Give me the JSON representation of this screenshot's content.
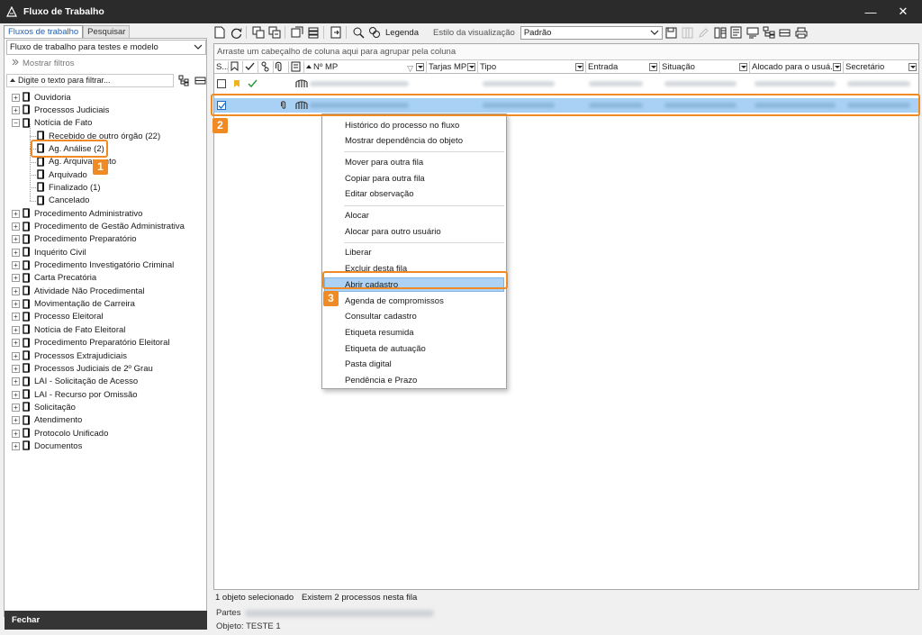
{
  "window": {
    "title": "Fluxo de Trabalho",
    "minimize_glyph": "—",
    "close_glyph": "✕",
    "icon": "app-logo-icon"
  },
  "left_panel": {
    "tabs": [
      {
        "label": "Fluxos de trabalho",
        "active": true
      },
      {
        "label": "Pesquisar",
        "active": false
      }
    ],
    "workflow_select": "Fluxo de trabalho para testes e modelo",
    "show_filters": "Mostrar filtros",
    "filter_placeholder": "Digite o texto para filtrar...",
    "tree": [
      {
        "label": "Ouvidoria",
        "expander": "+"
      },
      {
        "label": "Processos Judiciais",
        "expander": "+"
      },
      {
        "label": "Notícia de Fato",
        "expander": "−"
      },
      {
        "label": "Recebido de outro órgão (22)",
        "child": true
      },
      {
        "label": "Ag. Análise (2)",
        "child": true
      },
      {
        "label": "Ag. Arquivamento",
        "child": true
      },
      {
        "label": "Arquivado",
        "child": true
      },
      {
        "label": "Finalizado (1)",
        "child": true
      },
      {
        "label": "Cancelado",
        "child": true
      },
      {
        "label": "Procedimento Administrativo",
        "expander": "+"
      },
      {
        "label": "Procedimento de Gestão Administrativa",
        "expander": "+"
      },
      {
        "label": "Procedimento Preparatório",
        "expander": "+"
      },
      {
        "label": "Inquérito Civil",
        "expander": "+"
      },
      {
        "label": "Procedimento Investigatório Criminal",
        "expander": "+"
      },
      {
        "label": "Carta Precatória",
        "expander": "+"
      },
      {
        "label": "Atividade Não Procedimental",
        "expander": "+"
      },
      {
        "label": "Movimentação de Carreira",
        "expander": "+"
      },
      {
        "label": "Processo Eleitoral",
        "expander": "+"
      },
      {
        "label": "Notícia de Fato Eleitoral",
        "expander": "+"
      },
      {
        "label": "Procedimento Preparatório Eleitoral",
        "expander": "+"
      },
      {
        "label": "Processos Extrajudiciais",
        "expander": "+"
      },
      {
        "label": "Processos Judiciais de 2º Grau",
        "expander": "+"
      },
      {
        "label": "LAI - Solicitação de Acesso",
        "expander": "+"
      },
      {
        "label": "LAI - Recurso por Omissão",
        "expander": "+"
      },
      {
        "label": "Solicitação",
        "expander": "+"
      },
      {
        "label": "Atendimento",
        "expander": "+"
      },
      {
        "label": "Protocolo Unificado",
        "expander": "+"
      },
      {
        "label": "Documentos",
        "expander": "+"
      }
    ],
    "close_button": "Fechar"
  },
  "toolbar": {
    "legend": "Legenda",
    "view_style_label": "Estilo da visualização",
    "view_style_value": "Padrão"
  },
  "grid": {
    "group_hint": "Arraste um cabeçalho de coluna aqui para agrupar pela coluna",
    "columns": [
      "S...",
      "",
      "",
      "",
      "",
      "",
      "Nº MP",
      "Tarjas MP",
      "Tipo",
      "Entrada",
      "Situação",
      "Alocado para o usuá...",
      "Secretário"
    ]
  },
  "status": {
    "selected": "1 objeto selecionado",
    "count": "Existem 2 processos nesta fila",
    "parties_label": "Partes",
    "object": "Objeto: TESTE 1"
  },
  "context_menu": {
    "groups": [
      [
        "Histórico do processo no fluxo",
        "Mostrar dependência do objeto"
      ],
      [
        "Mover para outra fila",
        "Copiar para outra fila",
        "Editar observação"
      ],
      [
        "Alocar",
        "Alocar para outro usuário"
      ],
      [
        "Liberar",
        "Excluir desta fila",
        "Abrir cadastro",
        "Agenda de compromissos",
        "Consultar cadastro",
        "Etiqueta resumida",
        "Etiqueta de autuação",
        "Pasta digital",
        "Pendência e Prazo"
      ]
    ],
    "highlighted": "Abrir cadastro"
  },
  "callouts": [
    "1",
    "2",
    "3"
  ],
  "colors": {
    "accent": "#f08a24",
    "selection": "#a9d0f5",
    "titlebar": "#2b2b2b"
  }
}
